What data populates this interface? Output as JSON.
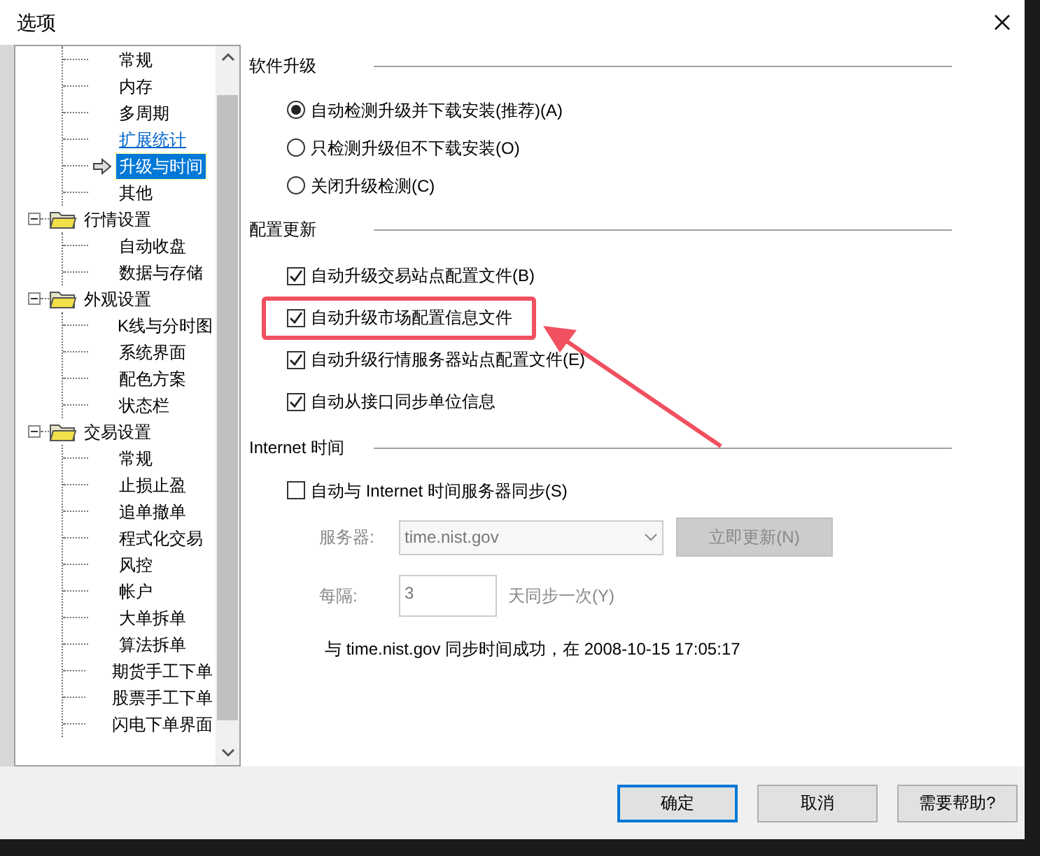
{
  "window": {
    "title": "选项"
  },
  "tree": {
    "items": [
      {
        "children": [
          {
            "label": "常规",
            "kind": "leaf",
            "selected": false
          },
          {
            "label": "内存",
            "kind": "leaf",
            "selected": false
          },
          {
            "label": "多周期",
            "kind": "leaf",
            "selected": false
          },
          {
            "label": "扩展统计",
            "kind": "link",
            "selected": false
          },
          {
            "label": "升级与时间",
            "kind": "leaf",
            "selected": true
          },
          {
            "label": "其他",
            "kind": "leaf",
            "selected": false
          }
        ]
      },
      {
        "label": "行情设置",
        "expanded": true,
        "children": [
          {
            "label": "自动收盘",
            "kind": "leaf",
            "selected": false
          },
          {
            "label": "数据与存储",
            "kind": "leaf",
            "selected": false
          }
        ]
      },
      {
        "label": "外观设置",
        "expanded": true,
        "children": [
          {
            "label": "K线与分时图",
            "kind": "leaf",
            "selected": false
          },
          {
            "label": "系统界面",
            "kind": "leaf",
            "selected": false
          },
          {
            "label": "配色方案",
            "kind": "leaf",
            "selected": false
          },
          {
            "label": "状态栏",
            "kind": "leaf",
            "selected": false
          }
        ]
      },
      {
        "label": "交易设置",
        "expanded": true,
        "children": [
          {
            "label": "常规",
            "kind": "leaf",
            "selected": false
          },
          {
            "label": "止损止盈",
            "kind": "leaf",
            "selected": false
          },
          {
            "label": "追单撤单",
            "kind": "leaf",
            "selected": false
          },
          {
            "label": "程式化交易",
            "kind": "leaf",
            "selected": false
          },
          {
            "label": "风控",
            "kind": "leaf",
            "selected": false
          },
          {
            "label": "帐户",
            "kind": "leaf",
            "selected": false
          },
          {
            "label": "大单拆单",
            "kind": "leaf",
            "selected": false
          },
          {
            "label": "算法拆单",
            "kind": "leaf",
            "selected": false
          },
          {
            "label": "期货手工下单",
            "kind": "leaf",
            "selected": false
          },
          {
            "label": "股票手工下单",
            "kind": "leaf",
            "selected": false
          },
          {
            "label": "闪电下单界面",
            "kind": "leaf",
            "selected": false
          }
        ]
      }
    ]
  },
  "sections": [
    {
      "title": "软件升级",
      "options": [
        {
          "kind": "radio",
          "label": "自动检测升级并下载安装(推荐)(A)",
          "selected": true,
          "highlighted": false
        },
        {
          "kind": "radio",
          "label": "只检测升级但不下载安装(O)",
          "selected": false,
          "highlighted": false
        },
        {
          "kind": "radio",
          "label": "关闭升级检测(C)",
          "selected": false,
          "highlighted": false
        }
      ]
    },
    {
      "title": "配置更新",
      "options": [
        {
          "kind": "checkbox",
          "label": "自动升级交易站点配置文件(B)",
          "checked": true,
          "highlighted": false
        },
        {
          "kind": "checkbox",
          "label": "自动升级市场配置信息文件",
          "checked": true,
          "highlighted": true
        },
        {
          "kind": "checkbox",
          "label": "自动升级行情服务器站点配置文件(E)",
          "checked": true,
          "highlighted": false
        },
        {
          "kind": "checkbox",
          "label": "自动从接口同步单位信息",
          "checked": true,
          "highlighted": false
        }
      ]
    }
  ],
  "internet_time": {
    "title": "Internet 时间",
    "sync": {
      "label": "自动与 Internet 时间服务器同步(S)",
      "checked": false
    },
    "server_label": "服务器:",
    "server": "time.nist.gov",
    "update_button": "立即更新(N)",
    "disabled": true,
    "interval_label": "每隔:",
    "interval": "3",
    "interval_unit": "天同步一次(Y)",
    "status": "与 time.nist.gov 同步时间成功，在 2008-10-15 17:05:17"
  },
  "buttons": [
    {
      "label": "确定",
      "default": true
    },
    {
      "label": "取消",
      "default": false
    },
    {
      "label": "需要帮助?",
      "default": false
    }
  ]
}
